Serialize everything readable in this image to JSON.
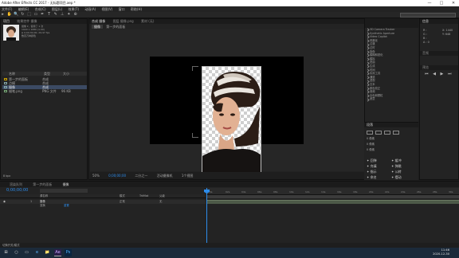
{
  "window": {
    "title": "Adobe After Effects CC 2017 - 无标题项目.aep *",
    "min": "—",
    "max": "□",
    "close": "✕"
  },
  "menu": [
    "文件(F)",
    "编辑(E)",
    "合成(C)",
    "图层(L)",
    "效果(T)",
    "动画(A)",
    "视图(V)",
    "窗口",
    "帮助(H)"
  ],
  "tools": [
    "▸",
    "✋",
    "🔍",
    "↻",
    "⬚",
    "▭",
    "✒",
    "T",
    "✎",
    "⊥",
    "✦",
    "⊕"
  ],
  "project": {
    "tabs": [
      "项目",
      "效果控件 摄像"
    ],
    "item_name": "摄像",
    "item_info": [
      "摄像 ▾，使用了 1 次",
      "1920 x 1080 (1.00)",
      "Δ 0;00;30;00, 29.97 fps",
      "数百万种颜色"
    ],
    "columns": [
      "名称",
      "类型",
      "大小"
    ],
    "rows": [
      {
        "name": "第一步的面板",
        "type": "合成",
        "size": "",
        "selected": false,
        "folder": true
      },
      {
        "name": "点模",
        "type": "合成",
        "size": "",
        "selected": false,
        "folder": false
      },
      {
        "name": "摄像",
        "type": "合成",
        "size": "",
        "selected": true,
        "folder": false
      },
      {
        "name": "蜡笔.png",
        "type": "PNG 文件",
        "size": "96 KB",
        "selected": false,
        "folder": false
      }
    ],
    "footer": "8 bpc"
  },
  "viewer": {
    "tabs": [
      "合成 摄像",
      "图层 摄像.png",
      "素材 (无)"
    ],
    "breadcrumbs": [
      "摄像",
      "第一步的面板"
    ],
    "zoom": "50%",
    "timecode": "0;00;00;00",
    "resolution": "二分之一",
    "camera": "活动摄像机",
    "views": "1个视图"
  },
  "effects": {
    "items": [
      "3D Camera Tracker",
      "Synthetic Aperture",
      "Video Copilot",
      "风格化",
      "过渡",
      "过时",
      "抠像",
      "模糊和锐化",
      "模拟",
      "扭曲",
      "生成",
      "时间",
      "实用工具",
      "通道",
      "透视",
      "文本",
      "颜色校正",
      "音频",
      "杂色和颗粒",
      "遮罩"
    ]
  },
  "paragraph": {
    "title": "段落",
    "values": [
      "0 像素",
      "0 像素",
      "0 像素"
    ],
    "align_buttons": [
      "对齐",
      "缩放",
      "统计",
      "平滑",
      "变形",
      "模糊",
      "指定"
    ],
    "actions": [
      [
        "✦ 回弹",
        "✦ 缓冲"
      ],
      [
        "✦ 充填",
        "✦ 弹跳"
      ],
      [
        "✦ 指示",
        "✦ 公转"
      ],
      [
        "✦ 命名",
        "✦ 摆动"
      ]
    ]
  },
  "right": {
    "tabs": [
      "信息",
      "音频",
      "预览"
    ],
    "labels": [
      "R :",
      "G :",
      "B :",
      "A : 0"
    ],
    "coords": "X: 1440",
    "coordy": "Y: 648"
  },
  "timeline": {
    "tabs": [
      "渲染队列",
      "第一步的面板",
      "摄像"
    ],
    "timecode": "0;00;00;00",
    "columns": [
      "源名称",
      "模式",
      "TrkMat",
      "父级"
    ],
    "layer": {
      "num": "1",
      "name": "摄像",
      "mode": "正常",
      "parent": "无"
    },
    "transform": "变换",
    "reset": "重置",
    "ticks": [
      "0s",
      "02s",
      "04s",
      "06s",
      "08s",
      "10s",
      "12s",
      "14s",
      "16s",
      "18s",
      "20s",
      "22s",
      "24s",
      "26s",
      "28s",
      "30s"
    ],
    "footer": "切换开关/模式"
  },
  "taskbar": {
    "apps": [
      "⊞",
      "○",
      "▭",
      "e",
      "📁",
      "Ae",
      "Ps"
    ],
    "time": "11:46",
    "date": "2020-12-30"
  }
}
